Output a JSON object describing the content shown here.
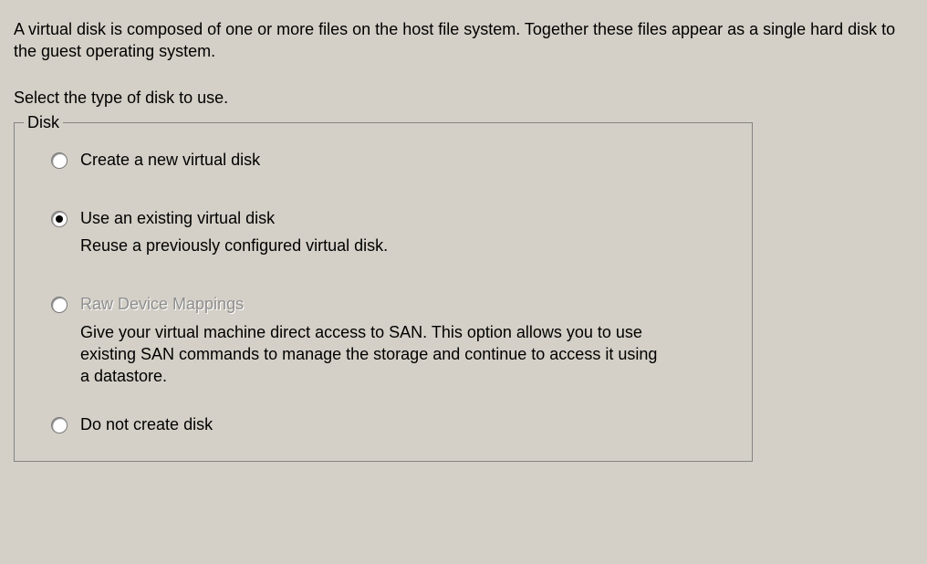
{
  "intro": "A virtual disk is composed of one or more files on the host file system. Together these files appear as a single hard disk to the guest operating system.",
  "prompt": "Select the type of disk to use.",
  "fieldset_legend": "Disk",
  "options": {
    "create": {
      "label": "Create a new virtual disk"
    },
    "existing": {
      "label": "Use an existing virtual disk",
      "desc": "Reuse a previously configured virtual disk."
    },
    "rdm": {
      "label": "Raw Device Mappings",
      "desc": "Give your virtual machine direct access to SAN. This option allows you to use existing SAN commands to manage the storage and continue to access it using a datastore."
    },
    "none": {
      "label": "Do not create disk"
    }
  }
}
